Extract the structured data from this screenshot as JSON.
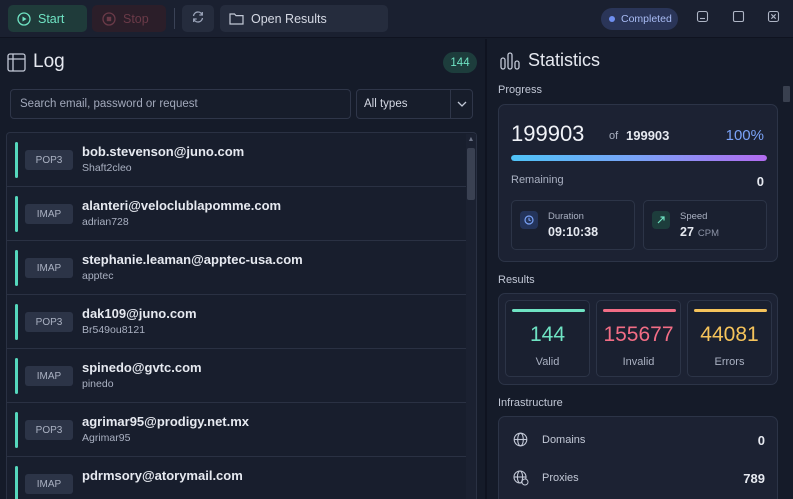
{
  "toolbar": {
    "start_label": "Start",
    "stop_label": "Stop",
    "open_results_label": "Open Results",
    "status_badge": "Completed",
    "colors": {
      "start": "#6fe3c3",
      "stop": "#6a3a48",
      "status": "#a9bcf5"
    }
  },
  "log": {
    "title": "Log",
    "count": "144",
    "search_placeholder": "Search email, password or request",
    "filter_value": "All types",
    "items": [
      {
        "protocol": "POP3",
        "email": "bob.stevenson@juno.com",
        "password": "Shaft2cleo"
      },
      {
        "protocol": "IMAP",
        "email": "alanteri@veloclublapomme.com",
        "password": "adrian728"
      },
      {
        "protocol": "IMAP",
        "email": "stephanie.leaman@apptec-usa.com",
        "password": "apptec"
      },
      {
        "protocol": "POP3",
        "email": "dak109@juno.com",
        "password": "Br549ou8121"
      },
      {
        "protocol": "IMAP",
        "email": "spinedo@gvtc.com",
        "password": "pinedo"
      },
      {
        "protocol": "POP3",
        "email": "agrimar95@prodigy.net.mx",
        "password": "Agrimar95"
      },
      {
        "protocol": "IMAP",
        "email": "pdrmsory@atorymail.com",
        "password": ""
      }
    ]
  },
  "statistics": {
    "title": "Statistics",
    "progress": {
      "section_label": "Progress",
      "processed": "199903",
      "of_label": "of",
      "total": "199903",
      "percent_label": "100%",
      "percent_value": 1.0,
      "remaining_label": "Remaining",
      "remaining_value": "0",
      "duration_label": "Duration",
      "duration_value": "09:10:38",
      "speed_label": "Speed",
      "speed_value": "27",
      "speed_unit": "CPM"
    },
    "results": {
      "section_label": "Results",
      "valid_value": "144",
      "valid_label": "Valid",
      "invalid_value": "155677",
      "invalid_label": "Invalid",
      "errors_value": "44081",
      "errors_label": "Errors",
      "colors": {
        "valid": "#6fe3c3",
        "invalid": "#f26d85",
        "errors": "#f5c35b"
      }
    },
    "infrastructure": {
      "section_label": "Infrastructure",
      "domains_label": "Domains",
      "domains_value": "0",
      "proxies_label": "Proxies",
      "proxies_value": "789"
    }
  }
}
